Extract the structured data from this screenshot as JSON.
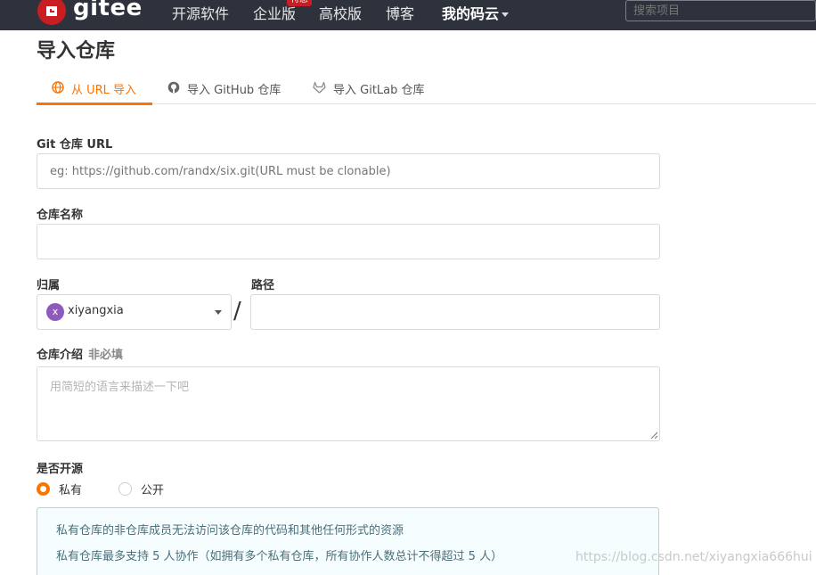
{
  "navbar": {
    "logo_text": "gitee",
    "items": [
      "开源软件",
      "企业版",
      "高校版",
      "博客",
      "我的码云"
    ],
    "promo_badge": "特惠",
    "search_placeholder": "搜索项目"
  },
  "page": {
    "title": "导入仓库"
  },
  "tabs": [
    {
      "label": "从 URL 导入",
      "active": true,
      "icon": "globe-icon"
    },
    {
      "label": "导入 GitHub 仓库",
      "active": false,
      "icon": "github-icon"
    },
    {
      "label": "导入 GitLab 仓库",
      "active": false,
      "icon": "gitlab-icon"
    }
  ],
  "form": {
    "git_url": {
      "label": "Git 仓库 URL",
      "placeholder": "eg: https://github.com/randx/six.git(URL must be clonable)"
    },
    "repo_name": {
      "label": "仓库名称",
      "value": ""
    },
    "owner": {
      "label": "归属",
      "value": "xiyangxia",
      "avatar_letter": "x"
    },
    "path": {
      "label": "路径",
      "value": "",
      "separator": "/"
    },
    "description": {
      "label": "仓库介绍",
      "optional_label": "非必填",
      "placeholder": "用简短的语言来描述一下吧"
    },
    "visibility": {
      "label": "是否开源",
      "options": [
        {
          "label": "私有",
          "selected": true
        },
        {
          "label": "公开",
          "selected": false
        }
      ]
    },
    "info": [
      "私有仓库的非仓库成员无法访问该仓库的代码和其他任何形式的资源",
      "私有仓库最多支持 5 人协作（如拥有多个私有仓库，所有协作人数总计不得超过 5 人）"
    ]
  },
  "watermark": "https://blog.csdn.net/xiyangxia666hui",
  "colors": {
    "accent": "#fe7300",
    "navbar": "#2d323c",
    "brand": "#c71d23"
  }
}
